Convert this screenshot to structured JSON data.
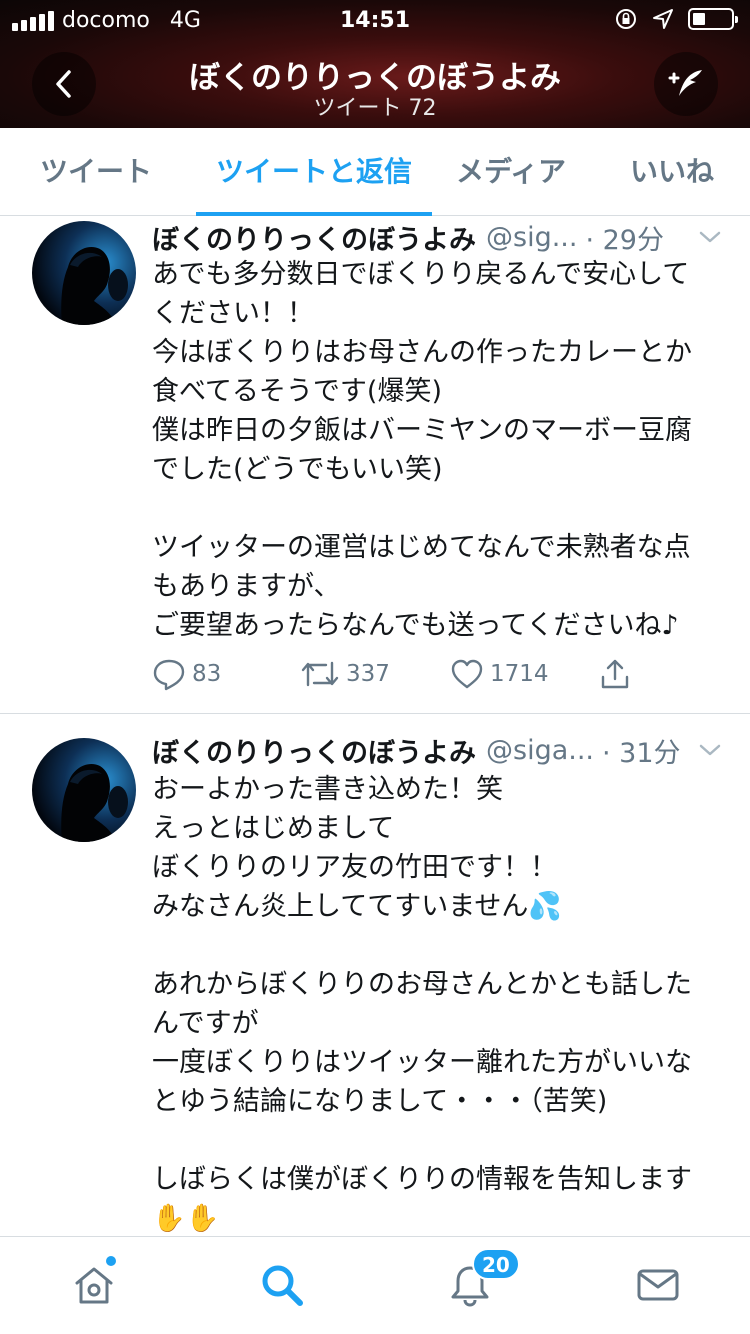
{
  "status_bar": {
    "carrier": "docomo",
    "network": "4G",
    "time": "14:51"
  },
  "header": {
    "title": "ぼくのりりっくのぼうよみ",
    "subtitle": "ツイート 72"
  },
  "tabs": [
    {
      "label": "ツイート"
    },
    {
      "label": "ツイートと返信"
    },
    {
      "label": "メディア"
    },
    {
      "label": "いいね"
    }
  ],
  "tweets": [
    {
      "name": "ぼくのりりっくのぼうよみ",
      "handle": "@sig...",
      "time": "· 29分",
      "lines": [
        "あでも多分数日でぼくりり戻るんで安心して",
        "ください！！",
        "今はぼくりりはお母さんの作ったカレーとか",
        "食べてるそうです(爆笑)",
        "僕は昨日の夕飯はバーミヤンのマーボー豆腐",
        "でした(どうでもいい笑)",
        "",
        "ツイッターの運営はじめてなんで未熟者な点",
        "もありますが、",
        "ご要望あったらなんでも送ってくださいね♪"
      ],
      "replies": "83",
      "retweets": "337",
      "likes": "1714"
    },
    {
      "name": "ぼくのりりっくのぼうよみ",
      "handle": "@siga...",
      "time": "· 31分",
      "lines": [
        "おーよかった書き込めた！笑",
        "えっとはじめまして",
        "ぼくりりのリア友の竹田です！！",
        "みなさん炎上しててすいません💦",
        "",
        "あれからぼくりりのお母さんとかとも話した",
        "んですが",
        "一度ぼくりりはツイッター離れた方がいいな",
        "とゆう結論になりまして・・・（苦笑)",
        "",
        "しばらくは僕がぼくりりの情報を告知します",
        "✋✋"
      ]
    }
  ],
  "notifications_badge": "20",
  "colors": {
    "accent": "#1da1f2",
    "secondary_text": "#657786",
    "divider": "#d8dde1"
  }
}
